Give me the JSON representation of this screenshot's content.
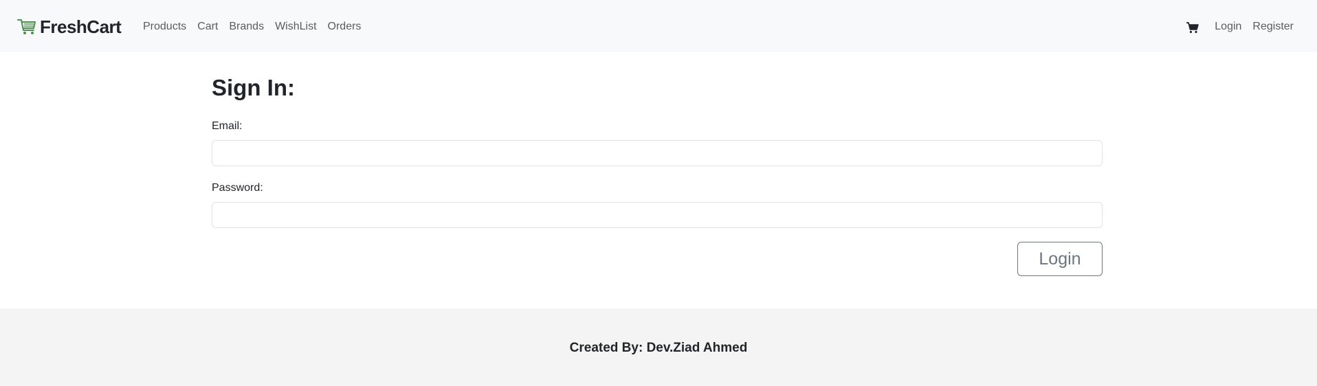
{
  "navbar": {
    "brand": {
      "name": "FreshCart",
      "icon": "shopping-cart-logo-icon"
    },
    "links": [
      {
        "label": "Products"
      },
      {
        "label": "Cart"
      },
      {
        "label": "Brands"
      },
      {
        "label": "WishList"
      },
      {
        "label": "Orders"
      }
    ],
    "right": {
      "cart_icon": "cart-icon",
      "login_label": "Login",
      "register_label": "Register"
    }
  },
  "main": {
    "title": "Sign In:",
    "email": {
      "label": "Email:",
      "value": "",
      "placeholder": ""
    },
    "password": {
      "label": "Password:",
      "value": "",
      "placeholder": ""
    },
    "submit_label": "Login"
  },
  "footer": {
    "text": "Created By: Dev.Ziad Ahmed"
  },
  "colors": {
    "navbar_bg": "#f8f9fa",
    "footer_bg": "#f4f4f4",
    "text": "#212529",
    "muted": "#6c757d",
    "brand_accent": "#4fa74f"
  }
}
